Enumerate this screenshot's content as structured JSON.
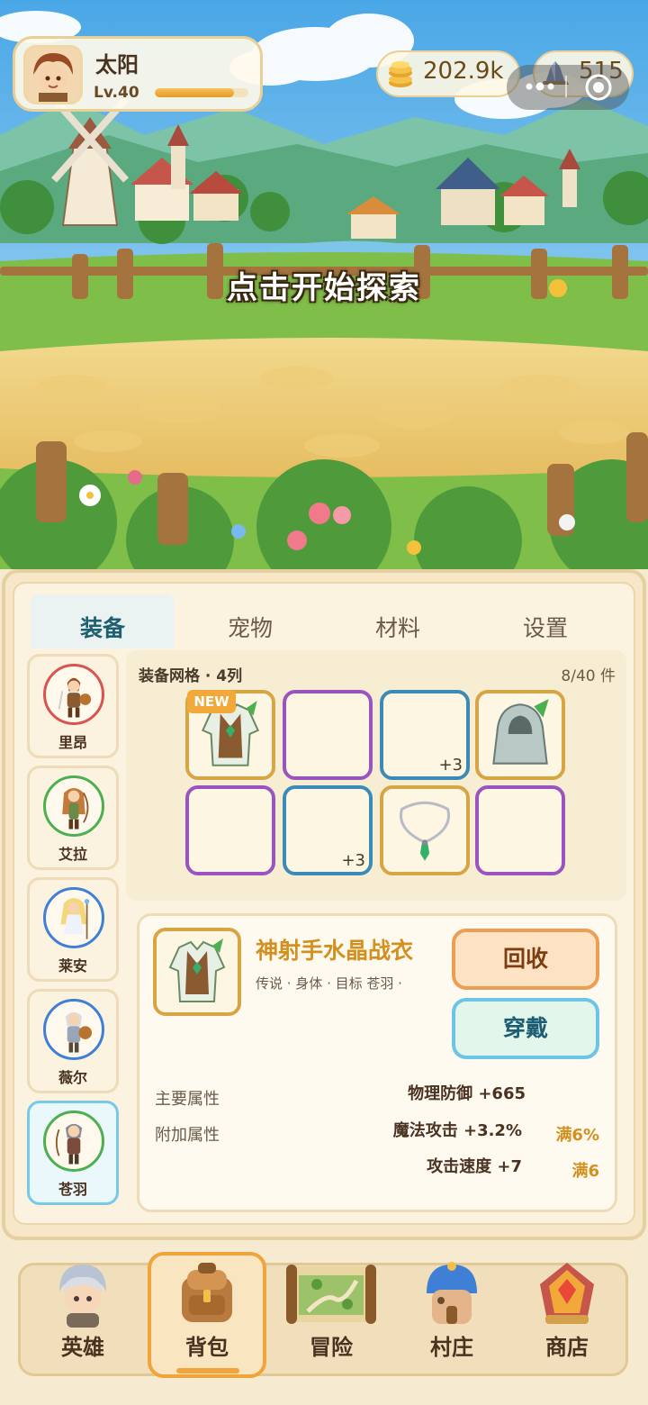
{
  "player": {
    "name": "太阳",
    "level": "Lv.40",
    "xp_fraction": 0.85
  },
  "currency": {
    "coins": "202.9k",
    "gems": "515"
  },
  "scene": {
    "action_label": "点击开始探索"
  },
  "tabs": [
    {
      "label": "装备",
      "active": true
    },
    {
      "label": "宠物",
      "active": false
    },
    {
      "label": "材料",
      "active": false
    },
    {
      "label": "设置",
      "active": false
    }
  ],
  "heroes": [
    {
      "name": "里昂",
      "ring_color": "#d9534f",
      "active": false
    },
    {
      "name": "艾拉",
      "ring_color": "#4caf50",
      "active": false
    },
    {
      "name": "莱安",
      "ring_color": "#3f7fd6",
      "active": false
    },
    {
      "name": "薇尔",
      "ring_color": "#3f7fd6",
      "active": false
    },
    {
      "name": "苍羽",
      "ring_color": "#4caf50",
      "active": true
    }
  ],
  "grid": {
    "title": "装备网格 · 4列",
    "count": "8/40 件",
    "new_tag": "NEW",
    "slots": [
      {
        "rarity_color": "#d7a544",
        "item": "green-robe-icon",
        "plus": ""
      },
      {
        "rarity_color": "#9b54bf",
        "item": "",
        "plus": ""
      },
      {
        "rarity_color": "#3a8bb8",
        "item": "",
        "plus": "+3"
      },
      {
        "rarity_color": "#d7a544",
        "item": "hood-cloak-icon",
        "plus": ""
      },
      {
        "rarity_color": "#9b54bf",
        "item": "",
        "plus": ""
      },
      {
        "rarity_color": "#3a8bb8",
        "item": "",
        "plus": "+3"
      },
      {
        "rarity_color": "#d7a544",
        "item": "necklace-icon",
        "plus": ""
      },
      {
        "rarity_color": "#9b54bf",
        "item": "",
        "plus": ""
      }
    ]
  },
  "detail": {
    "name": "神射手水晶战衣",
    "meta": "传说 · 身体 · 目标 苍羽 ·",
    "recycle_label": "回收",
    "equip_label": "穿戴",
    "main_attr_label": "主要属性",
    "extra_attr_label": "附加属性",
    "attrs": [
      {
        "value": "物理防御 +665",
        "max": ""
      },
      {
        "value": "魔法攻击 +3.2%",
        "max": "满6%"
      },
      {
        "value": "攻击速度 +7",
        "max": "满6"
      }
    ]
  },
  "nav": [
    {
      "label": "英雄",
      "icon": "hero-icon",
      "active": false
    },
    {
      "label": "背包",
      "icon": "backpack-icon",
      "active": true
    },
    {
      "label": "冒险",
      "icon": "map-scroll-icon",
      "active": false
    },
    {
      "label": "村庄",
      "icon": "village-house-icon",
      "active": false
    },
    {
      "label": "商店",
      "icon": "shop-icon",
      "active": false
    }
  ],
  "colors": {
    "accent": "#f0a43a",
    "gold_text": "#d3901f",
    "tab_active": "#1f5f72"
  }
}
